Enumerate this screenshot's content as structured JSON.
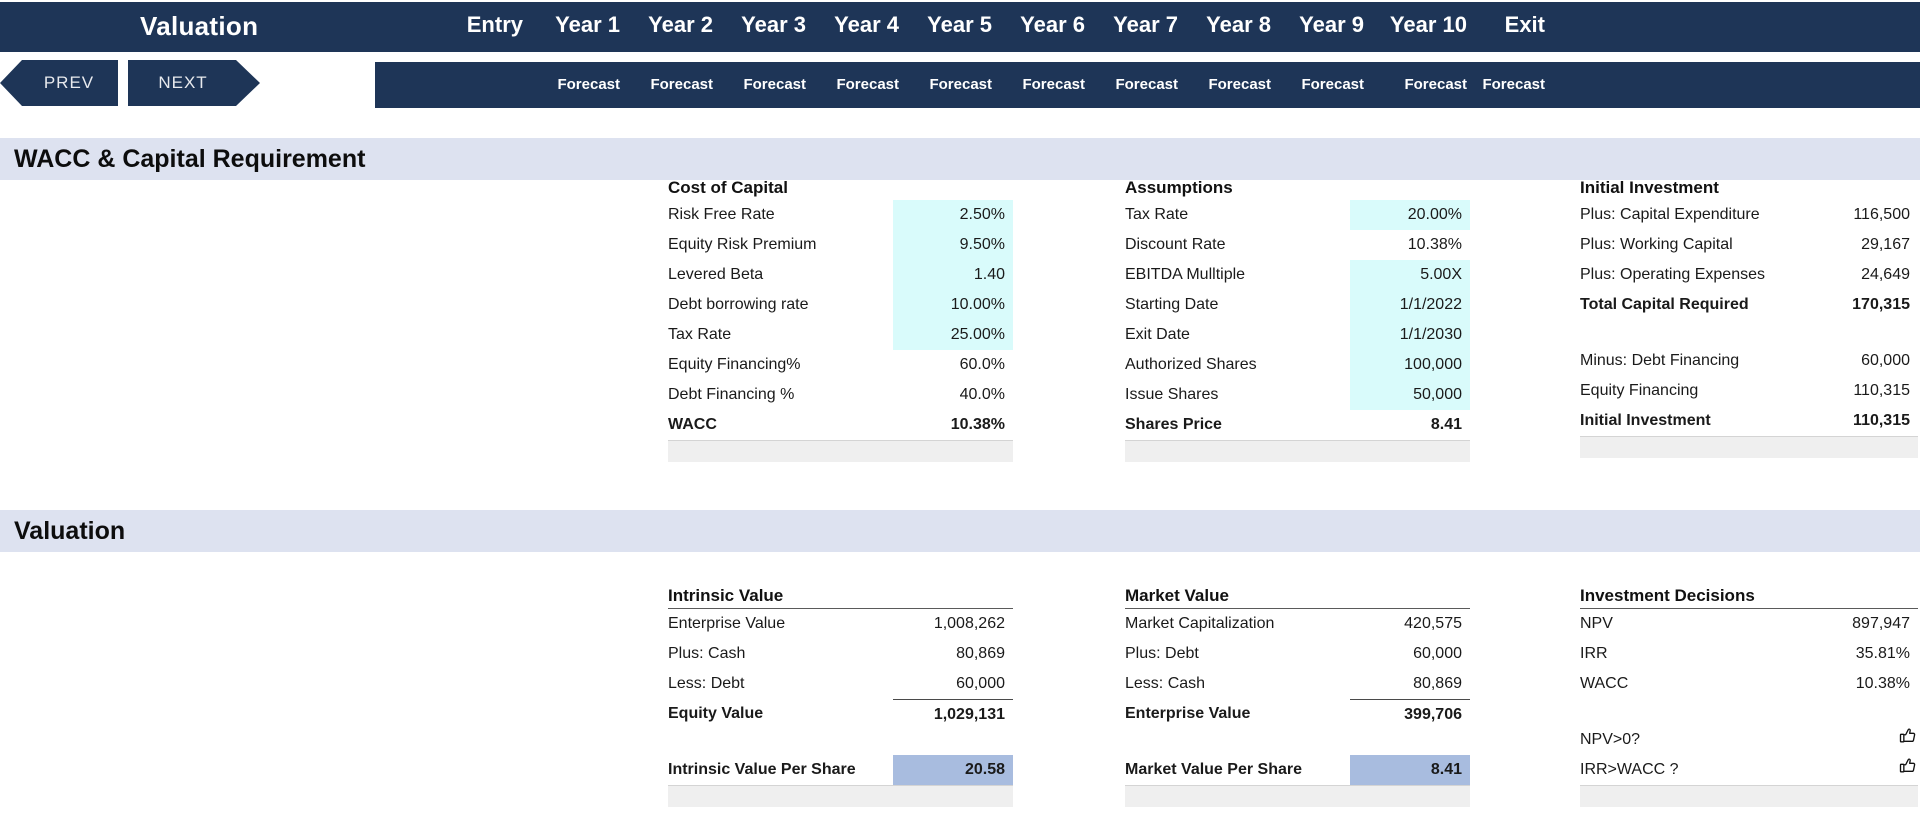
{
  "nav": {
    "title": "Valuation",
    "prev_label": "PREV",
    "next_label": "NEXT",
    "columns": [
      {
        "label": "Entry",
        "sub": ""
      },
      {
        "label": "Year 1",
        "sub": "Forecast"
      },
      {
        "label": "Year 2",
        "sub": "Forecast"
      },
      {
        "label": "Year 3",
        "sub": "Forecast"
      },
      {
        "label": "Year 4",
        "sub": "Forecast"
      },
      {
        "label": "Year 5",
        "sub": "Forecast"
      },
      {
        "label": "Year 6",
        "sub": "Forecast"
      },
      {
        "label": "Year 7",
        "sub": "Forecast"
      },
      {
        "label": "Year 8",
        "sub": "Forecast"
      },
      {
        "label": "Year 9",
        "sub": "Forecast"
      },
      {
        "label": "Year 10",
        "sub": "Forecast"
      },
      {
        "label": "Exit",
        "sub": "Forecast"
      }
    ]
  },
  "sections": {
    "wacc": {
      "title": "WACC & Capital Requirement"
    },
    "valuation": {
      "title": "Valuation"
    }
  },
  "cost_of_capital": {
    "title": "Cost of Capital",
    "rows": [
      {
        "label": "Risk Free Rate",
        "value": "2.50%",
        "style": "input"
      },
      {
        "label": "Equity Risk Premium",
        "value": "9.50%",
        "style": "input"
      },
      {
        "label": "Levered Beta",
        "value": "1.40",
        "style": "input"
      },
      {
        "label": "Debt borrowing rate",
        "value": "10.00%",
        "style": "input"
      },
      {
        "label": "Tax Rate",
        "value": "25.00%",
        "style": "input"
      },
      {
        "label": "Equity Financing%",
        "value": "60.0%",
        "style": ""
      },
      {
        "label": "Debt Financing %",
        "value": "40.0%",
        "style": ""
      },
      {
        "label": "WACC",
        "value": "10.38%",
        "style": "bold"
      }
    ]
  },
  "assumptions": {
    "title": "Assumptions",
    "rows": [
      {
        "label": "Tax Rate",
        "value": "20.00%",
        "style": "input"
      },
      {
        "label": "Discount Rate",
        "value": "10.38%",
        "style": ""
      },
      {
        "label": "EBITDA Mulltiple",
        "value": "5.00X",
        "style": "input"
      },
      {
        "label": "Starting Date",
        "value": "1/1/2022",
        "style": "input"
      },
      {
        "label": "Exit Date",
        "value": "1/1/2030",
        "style": "input"
      },
      {
        "label": "Authorized Shares",
        "value": "100,000",
        "style": "input"
      },
      {
        "label": "Issue Shares",
        "value": "50,000",
        "style": "input"
      },
      {
        "label": "Shares Price",
        "value": "8.41",
        "style": "bold"
      }
    ]
  },
  "initial_investment": {
    "title": "Initial Investment",
    "rows": [
      {
        "label": "Plus: Capital Expenditure",
        "value": "116,500",
        "style": ""
      },
      {
        "label": "Plus: Working Capital",
        "value": "29,167",
        "style": ""
      },
      {
        "label": "Plus: Operating Expenses",
        "value": "24,649",
        "style": ""
      },
      {
        "label": "Total Capital Required",
        "value": "170,315",
        "style": "bold"
      },
      {
        "label": "",
        "value": "",
        "style": "spacer"
      },
      {
        "label": "Minus: Debt Financing",
        "value": "60,000",
        "style": ""
      },
      {
        "label": "Equity Financing",
        "value": "110,315",
        "style": ""
      },
      {
        "label": "Initial Investment",
        "value": "110,315",
        "style": "bold"
      }
    ]
  },
  "intrinsic_value": {
    "title": "Intrinsic Value",
    "rows": [
      {
        "label": "Enterprise Value",
        "value": "1,008,262",
        "style": ""
      },
      {
        "label": "Plus: Cash",
        "value": "80,869",
        "style": ""
      },
      {
        "label": "Less: Debt",
        "value": "60,000",
        "style": ""
      },
      {
        "label": "Equity Value",
        "value": "1,029,131",
        "style": "bold-rule"
      }
    ],
    "per_share": {
      "label": "Intrinsic Value Per Share",
      "value": "20.58"
    }
  },
  "market_value": {
    "title": "Market Value",
    "rows": [
      {
        "label": "Market Capitalization",
        "value": "420,575",
        "style": ""
      },
      {
        "label": "Plus: Debt",
        "value": "60,000",
        "style": ""
      },
      {
        "label": "Less: Cash",
        "value": "80,869",
        "style": ""
      },
      {
        "label": "Enterprise Value",
        "value": "399,706",
        "style": "bold-rule"
      }
    ],
    "per_share": {
      "label": "Market Value Per Share",
      "value": "8.41"
    }
  },
  "investment_decisions": {
    "title": "Investment Decisions",
    "rows": [
      {
        "label": "NPV",
        "value": "897,947",
        "style": ""
      },
      {
        "label": "IRR",
        "value": "35.81%",
        "style": ""
      },
      {
        "label": "WACC",
        "value": "10.38%",
        "style": ""
      }
    ],
    "checks": [
      {
        "label": "NPV>0?",
        "icon": "thumbs-up",
        "glyph": "👍"
      },
      {
        "label": "IRR>WACC ?",
        "icon": "thumbs-up",
        "glyph": "👍"
      }
    ]
  },
  "colors": {
    "nav_blue": "#1e3557",
    "section_bar": "#dde2f0",
    "input_cell": "#d9fbfb",
    "highlight_cell": "#a8bcdf"
  }
}
